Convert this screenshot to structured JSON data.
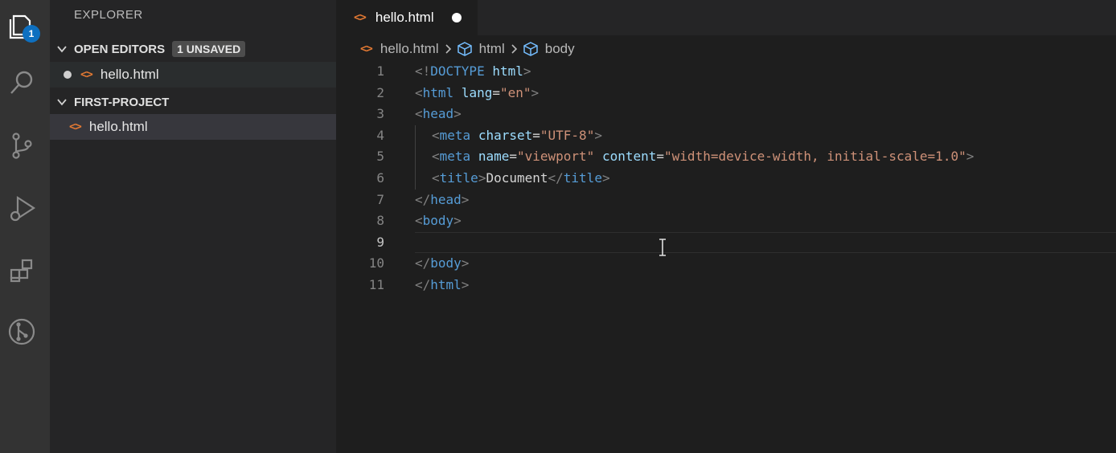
{
  "explorer": {
    "title": "EXPLORER",
    "badge_count": "1",
    "open_editors": {
      "label": "OPEN EDITORS",
      "unsaved_badge": "1 UNSAVED",
      "file": "hello.html"
    },
    "project": {
      "label": "FIRST-PROJECT",
      "file": "hello.html"
    }
  },
  "tab": {
    "label": "hello.html",
    "dirty": true
  },
  "breadcrumb": [
    "hello.html",
    "html",
    "body"
  ],
  "editor": {
    "current_line": 9,
    "lines": [
      {
        "n": "1",
        "indent": 0,
        "tokens": [
          {
            "c": "t",
            "v": "<!"
          },
          {
            "c": "tn",
            "v": "DOCTYPE"
          },
          {
            "c": "tx",
            "v": " "
          },
          {
            "c": "an",
            "v": "html"
          },
          {
            "c": "t",
            "v": ">"
          }
        ]
      },
      {
        "n": "2",
        "indent": 0,
        "tokens": [
          {
            "c": "t",
            "v": "<"
          },
          {
            "c": "tn",
            "v": "html"
          },
          {
            "c": "tx",
            "v": " "
          },
          {
            "c": "an",
            "v": "lang"
          },
          {
            "c": "tx",
            "v": "="
          },
          {
            "c": "av",
            "v": "\"en\""
          },
          {
            "c": "t",
            "v": ">"
          }
        ]
      },
      {
        "n": "3",
        "indent": 0,
        "tokens": [
          {
            "c": "t",
            "v": "<"
          },
          {
            "c": "tn",
            "v": "head"
          },
          {
            "c": "t",
            "v": ">"
          }
        ]
      },
      {
        "n": "4",
        "indent": 1,
        "tokens": [
          {
            "c": "t",
            "v": "<"
          },
          {
            "c": "tn",
            "v": "meta"
          },
          {
            "c": "tx",
            "v": " "
          },
          {
            "c": "an",
            "v": "charset"
          },
          {
            "c": "tx",
            "v": "="
          },
          {
            "c": "av",
            "v": "\"UTF-8\""
          },
          {
            "c": "t",
            "v": ">"
          }
        ]
      },
      {
        "n": "5",
        "indent": 1,
        "tokens": [
          {
            "c": "t",
            "v": "<"
          },
          {
            "c": "tn",
            "v": "meta"
          },
          {
            "c": "tx",
            "v": " "
          },
          {
            "c": "an",
            "v": "name"
          },
          {
            "c": "tx",
            "v": "="
          },
          {
            "c": "av",
            "v": "\"viewport\""
          },
          {
            "c": "tx",
            "v": " "
          },
          {
            "c": "an",
            "v": "content"
          },
          {
            "c": "tx",
            "v": "="
          },
          {
            "c": "av",
            "v": "\"width=device-width, initial-scale=1.0\""
          },
          {
            "c": "t",
            "v": ">"
          }
        ]
      },
      {
        "n": "6",
        "indent": 1,
        "tokens": [
          {
            "c": "t",
            "v": "<"
          },
          {
            "c": "tn",
            "v": "title"
          },
          {
            "c": "t",
            "v": ">"
          },
          {
            "c": "tx",
            "v": "Document"
          },
          {
            "c": "t",
            "v": "</"
          },
          {
            "c": "tn",
            "v": "title"
          },
          {
            "c": "t",
            "v": ">"
          }
        ]
      },
      {
        "n": "7",
        "indent": 0,
        "tokens": [
          {
            "c": "t",
            "v": "</"
          },
          {
            "c": "tn",
            "v": "head"
          },
          {
            "c": "t",
            "v": ">"
          }
        ]
      },
      {
        "n": "8",
        "indent": 0,
        "tokens": [
          {
            "c": "t",
            "v": "<"
          },
          {
            "c": "tn",
            "v": "body"
          },
          {
            "c": "t",
            "v": ">"
          }
        ]
      },
      {
        "n": "9",
        "indent": 0,
        "tokens": []
      },
      {
        "n": "10",
        "indent": 0,
        "tokens": [
          {
            "c": "t",
            "v": "</"
          },
          {
            "c": "tn",
            "v": "body"
          },
          {
            "c": "t",
            "v": ">"
          }
        ]
      },
      {
        "n": "11",
        "indent": 0,
        "tokens": [
          {
            "c": "t",
            "v": "</"
          },
          {
            "c": "tn",
            "v": "html"
          },
          {
            "c": "t",
            "v": ">"
          }
        ]
      }
    ]
  },
  "colors": {
    "accent": "#0e70c0",
    "html_icon": "#e37933",
    "tag": "#569cd6",
    "attr": "#9cdcfe",
    "string": "#ce9178"
  }
}
